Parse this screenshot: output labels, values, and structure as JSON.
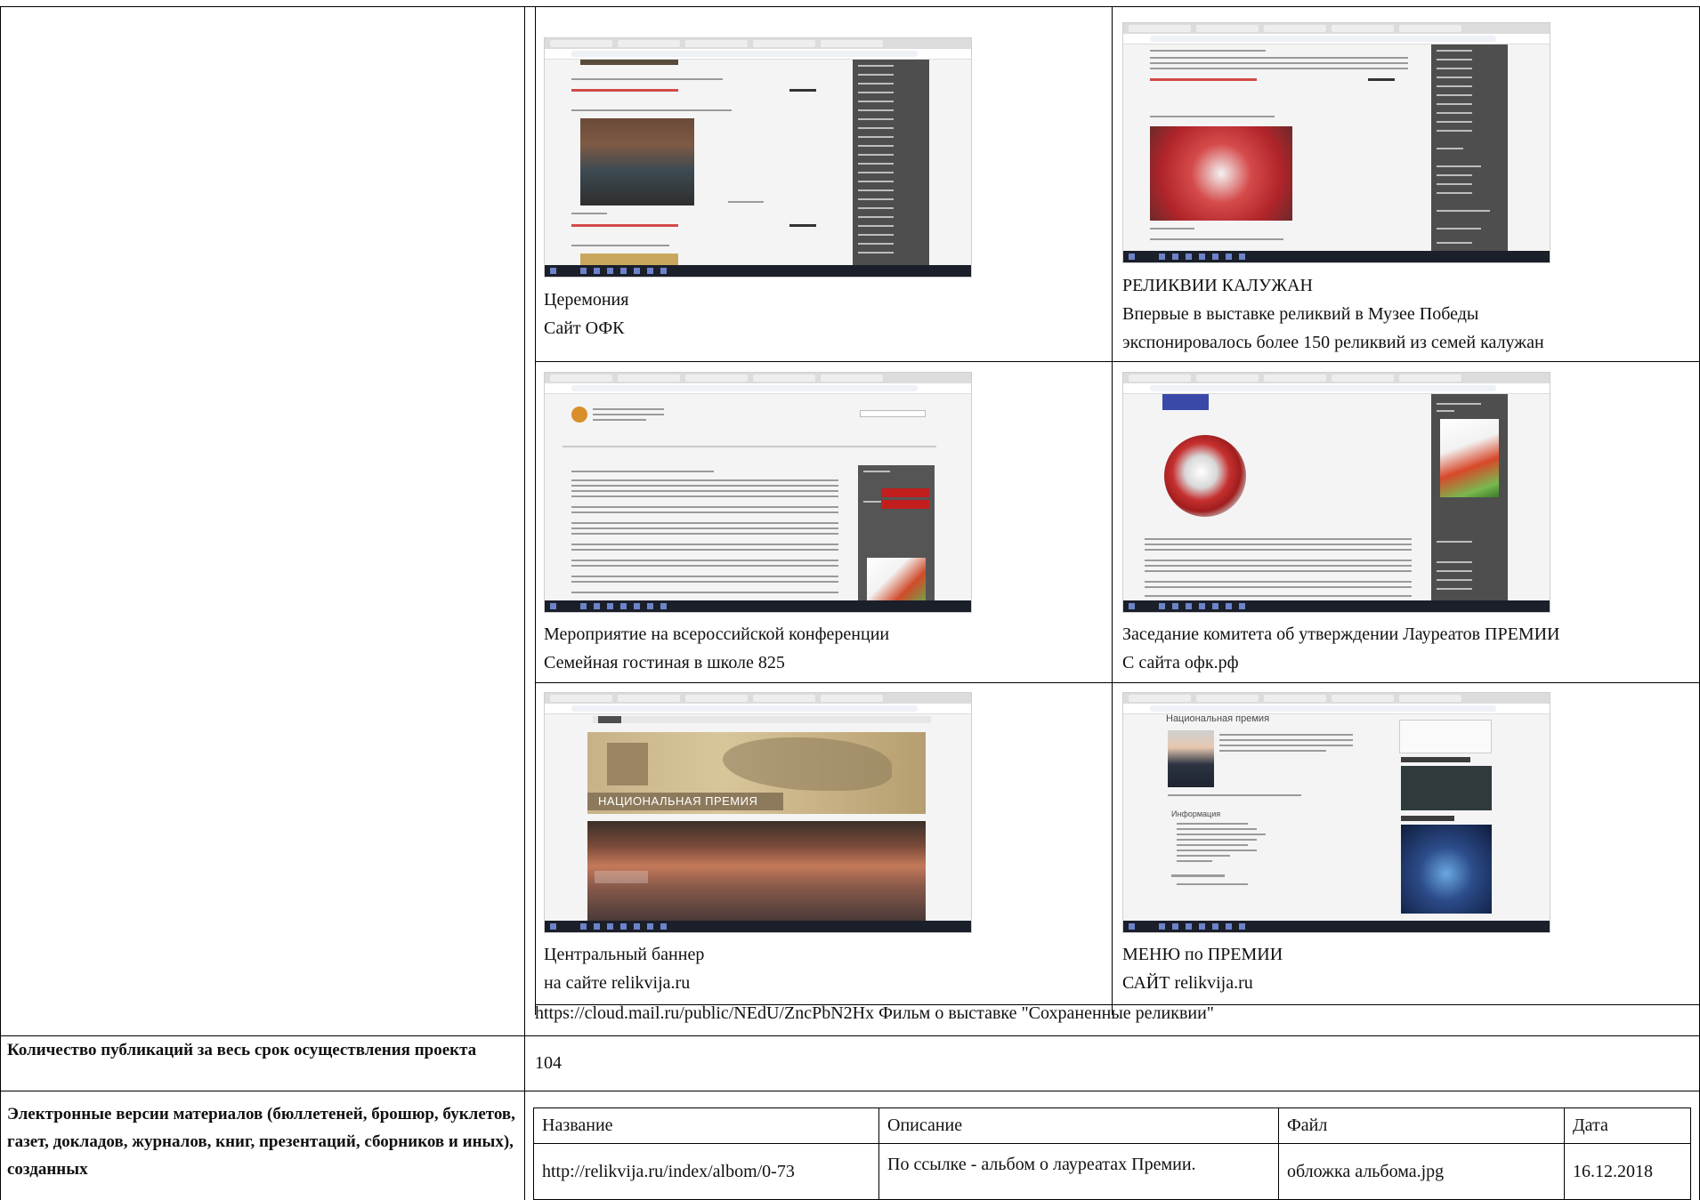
{
  "gallery": [
    {
      "caption_1": "Церемония",
      "caption_2": "Сайт ОФК"
    },
    {
      "caption_1": "РЕЛИКВИИ КАЛУЖАН",
      "caption_2": "Впервые в выставке реликвий в Музее Победы",
      "caption_3": "экспонировалось более 150 реликвий из семей калужан"
    },
    {
      "caption_1": "Мероприятие на всероссийской конференции",
      "caption_2": "Семейная гостиная в школе 825"
    },
    {
      "caption_1": "Заседание комитета об утверждении Лауреатов ПРЕМИИ",
      "caption_2": "С сайта офк.рф"
    },
    {
      "caption_1": "Центральный баннер",
      "caption_2": "на сайте relikvija.ru",
      "banner_text": "НАЦИОНАЛЬНАЯ ПРЕМИЯ"
    },
    {
      "caption_1": "МЕНЮ по ПРЕМИИ",
      "caption_2": "САЙТ relikvija.ru",
      "page_heading": "Национальная премия",
      "section_heading": "Информация"
    }
  ],
  "film_link": "https://cloud.mail.ru/public/NEdU/ZncPbN2Hx Фильм о выставке \"Сохраненные реликвии\"",
  "publications": {
    "label": "Количество публикаций за весь срок осуществления проекта",
    "value": "104"
  },
  "electronic": {
    "label": "Электронные версии материалов (бюллетеней, брошюр, буклетов, газет, докладов, журналов, книг, презентаций, сборников и иных), созданных",
    "headers": [
      "Название",
      "Описание",
      "Файл",
      "Дата"
    ],
    "rows": [
      [
        "http://relikvija.ru/index/albom/0-73",
        "По ссылке - альбом о лауреатах Премии.",
        "обложка альбома.jpg",
        "16.12.2018"
      ]
    ]
  }
}
